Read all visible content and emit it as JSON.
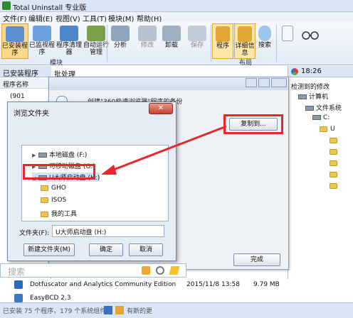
{
  "window": {
    "title": "Total Uninstall 专业版"
  },
  "menu": [
    "文件(F)",
    "编辑(E)",
    "视图(V)",
    "工具(T)",
    "模块(M)",
    "帮助(H)"
  ],
  "ribbon": {
    "buttons": [
      {
        "label": "已安装程序"
      },
      {
        "label": "已监视程序"
      },
      {
        "label": "程序清理器"
      },
      {
        "label": "自动运行管理"
      },
      {
        "label": "分析"
      },
      {
        "label": "修改"
      },
      {
        "label": "卸载"
      },
      {
        "label": "保存"
      },
      {
        "label": "程序"
      },
      {
        "label": "详细信息"
      },
      {
        "label": "搜索"
      }
    ],
    "group_modules": "模块",
    "group_layout": "布局"
  },
  "left_panel": {
    "header": "已安装程序",
    "col": "程序名称",
    "row1": "(901",
    "tab": "批处理"
  },
  "right_panel": {
    "time": "18:26",
    "subtitle": "检测到的修改",
    "tree": [
      "计算机",
      "文件系统",
      "C:",
      "U"
    ]
  },
  "bg_dialog": {
    "title": "创建\"360极速浏览器\"程序的备份",
    "copy_button": "复制到...",
    "done_button": "完成"
  },
  "browse_dialog": {
    "title": "浏览文件夹",
    "close": "✕",
    "items": [
      {
        "label": "本地磁盘 (F:)",
        "type": "drive"
      },
      {
        "label": "可移动磁盘 (G:)",
        "type": "drive"
      },
      {
        "label": "U大师启动盘 (H:)",
        "type": "drive"
      },
      {
        "label": "GHO",
        "type": "folder"
      },
      {
        "label": "ISOS",
        "type": "folder"
      },
      {
        "label": "我的工具",
        "type": "folder"
      }
    ],
    "folder_label": "文件夹(F):",
    "folder_value": "U大师启动盘 (H:)",
    "new_folder": "新建文件夹(M)",
    "ok": "确定",
    "cancel": "取消"
  },
  "search": {
    "placeholder": "搜索"
  },
  "list": [
    {
      "name": "Dotfuscator and Analytics Community Edition",
      "date": "2015/11/8 13:58",
      "size": "9.79 MB"
    },
    {
      "name": "EasyBCD 2.3",
      "date": "",
      "size": ""
    }
  ],
  "status": {
    "text": "已安装 75 个程序，179 个系统组件",
    "right": "有新的更"
  },
  "colors": {
    "highlight": "#e8262c",
    "arrow": "#e8262c"
  }
}
